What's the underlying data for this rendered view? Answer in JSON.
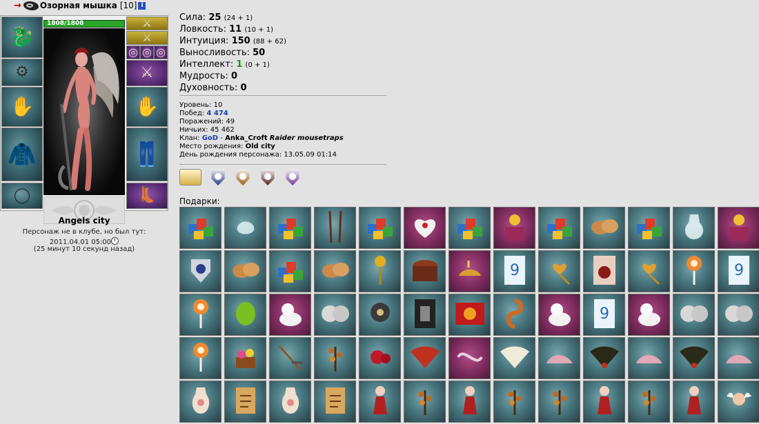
{
  "character": {
    "nick": "Озорная мышка",
    "level": "[10]",
    "hp": "1808/1808",
    "hp_fraction": 1.0,
    "location": "Angels city",
    "status": "Персонаж не в клубе, но был тут:",
    "last_seen": "2011.04.01 05:00",
    "ago": "(25 минут 10 секунд назад)"
  },
  "equipment": {
    "left": [
      "helmet-icon",
      "bracers-icon",
      "gloves-icon",
      "armor-icon",
      "belt-icon"
    ],
    "right": [
      "weapon-icon",
      "weapon-icon",
      "ring-icon",
      "weapon-icon",
      "gloves-icon",
      "pants-icon",
      "boots-icon"
    ]
  },
  "stats": [
    {
      "label": "Сила:",
      "value": "25",
      "breakdown": "(24 + 1)",
      "color": "#000000"
    },
    {
      "label": "Ловкость:",
      "value": "11",
      "breakdown": "(10 + 1)",
      "color": "#000000"
    },
    {
      "label": "Интуиция:",
      "value": "150",
      "breakdown": "(88 + 62)",
      "color": "#000000"
    },
    {
      "label": "Выносливость:",
      "value": "50",
      "breakdown": "",
      "color": "#000000"
    },
    {
      "label": "Интеллект:",
      "value": "1",
      "breakdown": "(0 + 1)",
      "color": "#2a8a2a"
    },
    {
      "label": "Мудрость:",
      "value": "0",
      "breakdown": "",
      "color": "#000000"
    },
    {
      "label": "Духовность:",
      "value": "0",
      "breakdown": "",
      "color": "#000000"
    }
  ],
  "info": {
    "level_label": "Уровень:",
    "level_value": "10",
    "wins_label": "Побед:",
    "wins_value": "4 474",
    "losses_label": "Поражений:",
    "losses_value": "49",
    "draws_label": "Ничьих:",
    "draws_value": "45 462",
    "clan_label": "Клан:",
    "clan_value": "GoD",
    "clan_sep": " - ",
    "clan_owner": "Anka_Croft",
    "clan_title": "Raider mousetraps",
    "birthplace_label": "Место рождения:",
    "birthplace_value": "Old city",
    "birthday_label": "День рождения персонажа:",
    "birthday_value": "13.05.09 01:14"
  },
  "badges": [
    "ring-badge-icon",
    "shield-badge-icon",
    "shield-badge-icon",
    "shield-badge-icon",
    "purple-badge-icon"
  ],
  "gifts_label": "Подарки:",
  "gifts": [
    [
      "gift-boxes-icon",
      "teal"
    ],
    [
      "crystal-bag-icon",
      "teal"
    ],
    [
      "gift-boxes-icon",
      "teal"
    ],
    [
      "staffs-icon",
      "teal"
    ],
    [
      "gift-boxes-icon",
      "teal"
    ],
    [
      "lace-heart-icon",
      "pink"
    ],
    [
      "gift-boxes-icon",
      "teal"
    ],
    [
      "jack-in-box-icon",
      "pink"
    ],
    [
      "gift-boxes-icon",
      "teal"
    ],
    [
      "bread-icon",
      "teal"
    ],
    [
      "gift-boxes-icon",
      "teal"
    ],
    [
      "crystal-vase-icon",
      "teal"
    ],
    [
      "jack-in-box-icon",
      "pink"
    ],
    [
      "shield-medal-icon",
      "teal"
    ],
    [
      "bread-icon",
      "teal"
    ],
    [
      "gift-boxes-icon",
      "teal"
    ],
    [
      "bread-icon",
      "teal"
    ],
    [
      "golden-rose-icon",
      "teal"
    ],
    [
      "treasure-chest-icon",
      "teal"
    ],
    [
      "magic-lamp-icon",
      "pink"
    ],
    [
      "card-icon",
      "teal"
    ],
    [
      "heart-key-icon",
      "teal"
    ],
    [
      "poster-icon",
      "teal"
    ],
    [
      "heart-key-icon",
      "teal"
    ],
    [
      "lollipop-icon",
      "teal"
    ],
    [
      "card-icon",
      "teal"
    ],
    [
      "lollipop-icon",
      "teal"
    ],
    [
      "green-gem-icon",
      "teal"
    ],
    [
      "white-cat-icon",
      "pink"
    ],
    [
      "silver-coins-icon",
      "teal"
    ],
    [
      "amulet-icon",
      "teal"
    ],
    [
      "dark-card-icon",
      "teal"
    ],
    [
      "fire-card-icon",
      "teal"
    ],
    [
      "pretzel-icon",
      "teal"
    ],
    [
      "white-cat-icon",
      "pink"
    ],
    [
      "card-icon",
      "teal"
    ],
    [
      "white-cat-icon",
      "pink"
    ],
    [
      "silver-coins-icon",
      "teal"
    ],
    [
      "silver-coins-icon",
      "teal"
    ],
    [
      "lollipop-icon",
      "teal"
    ],
    [
      "flower-basket-icon",
      "teal"
    ],
    [
      "rake-icon",
      "teal"
    ],
    [
      "flower-branch-icon",
      "teal"
    ],
    [
      "red-rose-icon",
      "teal"
    ],
    [
      "red-fan-icon",
      "teal"
    ],
    [
      "lace-ribbon-icon",
      "pink"
    ],
    [
      "white-fan-icon",
      "teal"
    ],
    [
      "glass-slipper-icon",
      "teal"
    ],
    [
      "black-fan-icon",
      "teal"
    ],
    [
      "glass-slipper-icon",
      "teal"
    ],
    [
      "black-fan-icon",
      "teal"
    ],
    [
      "glass-slipper-icon",
      "teal"
    ],
    [
      "vase-icon",
      "teal"
    ],
    [
      "scroll-icon",
      "teal"
    ],
    [
      "vase-icon",
      "teal"
    ],
    [
      "scroll-icon",
      "teal"
    ],
    [
      "red-doll-icon",
      "teal"
    ],
    [
      "flower-branch-icon",
      "teal"
    ],
    [
      "red-doll-icon",
      "teal"
    ],
    [
      "flower-branch-icon",
      "teal"
    ],
    [
      "flower-branch-icon",
      "teal"
    ],
    [
      "red-doll-icon",
      "teal"
    ],
    [
      "flower-branch-icon",
      "teal"
    ],
    [
      "red-doll-icon",
      "teal"
    ],
    [
      "cupid-icon",
      "teal"
    ]
  ],
  "colors": {
    "background": "#e2e2e2",
    "hp": "#2aa52a",
    "link": "#1a3da8",
    "gift_teal": "#4a7880",
    "gift_pink": "#7e2c5e"
  }
}
